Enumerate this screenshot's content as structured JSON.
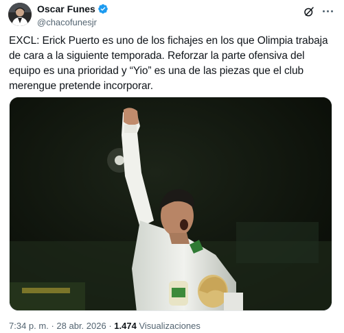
{
  "author": {
    "display_name": "Oscar Funes",
    "handle": "@chacofunesjr",
    "verified": true,
    "verified_color": "#1d9bf0"
  },
  "icons": {
    "verified": "verified-badge-icon",
    "grok": "grok-icon",
    "more": "more-options-icon"
  },
  "tweet": {
    "text": "EXCL: Erick Puerto es uno de los fichajes en los que Olimpia trabaja de cara a la siguiente temporada. Reforzar la parte ofensiva del equipo es una prioridad y “Yio” es una de las piezas que el club merengue pretende incorporar."
  },
  "media": {
    "type": "photo",
    "subject": "player celebrating with raised fist in white jersey"
  },
  "meta": {
    "time": "7:34 p. m.",
    "separator": "·",
    "date": "28 abr. 2026",
    "views_count": "1.474",
    "views_label": "Visualizaciones"
  },
  "colors": {
    "text_primary": "#0f1419",
    "text_secondary": "#536471",
    "background": "#ffffff"
  }
}
